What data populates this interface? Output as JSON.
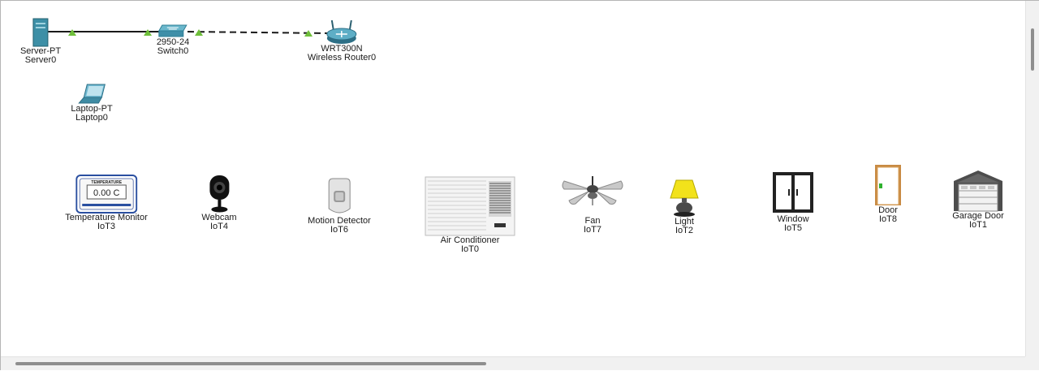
{
  "network": {
    "server": {
      "model": "Server-PT",
      "name": "Server0"
    },
    "switch": {
      "model": "2950-24",
      "name": "Switch0"
    },
    "router": {
      "model": "WRT300N",
      "name": "Wireless Router0"
    },
    "laptop": {
      "model": "Laptop-PT",
      "name": "Laptop0"
    }
  },
  "iot": {
    "temperature": {
      "model": "Temperature Monitor",
      "name": "IoT3",
      "display": "0.00 C",
      "header": "TEMPERATURE"
    },
    "webcam": {
      "model": "Webcam",
      "name": "IoT4"
    },
    "motion": {
      "model": "Motion Detector",
      "name": "IoT6"
    },
    "aircon": {
      "model": "Air Conditioner",
      "name": "IoT0"
    },
    "fan": {
      "model": "Fan",
      "name": "IoT7"
    },
    "light": {
      "model": "Light",
      "name": "IoT2"
    },
    "window": {
      "model": "Window",
      "name": "IoT5"
    },
    "door": {
      "model": "Door",
      "name": "IoT8"
    },
    "garage": {
      "model": "Garage Door",
      "name": "IoT1"
    }
  },
  "colors": {
    "link_up": "#6fbf3a",
    "link_line": "#1a1a1a",
    "light_shade": "#f2e21b"
  }
}
